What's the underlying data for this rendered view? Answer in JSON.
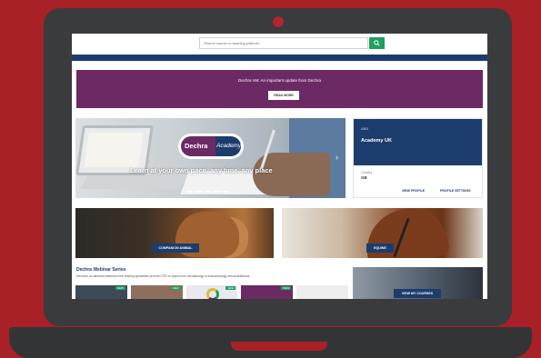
{
  "search": {
    "placeholder": "Search course or learning platform"
  },
  "banner": {
    "text": "Dechra Vet: An important update from Dechra",
    "button_label": "READ MORE"
  },
  "hero": {
    "logo_left": "Dechra",
    "logo_right": "Academy",
    "caption": "Learn at your own pace, any time, any place"
  },
  "side_card": {
    "small_text": "ABS",
    "title": "Academy UK",
    "field_label": "Country",
    "field_value": "GB",
    "link_1": "VIEW PROFILE",
    "link_2": "PROFILE SETTINGS"
  },
  "tiles": {
    "companion_label": "COMPANION ANIMAL",
    "equine_label": "EQUINE"
  },
  "webinars": {
    "title": "Dechra Webinar Series",
    "description": "Dechra's on-demand webinars from leading specialists provide CPD on topics from dermatology to endocrinology and anaesthesia.",
    "badge": "NEW"
  },
  "courses": {
    "button_label": "VIEW MY COURSES"
  },
  "colors": {
    "background": "#a82127",
    "brand_navy": "#1c3c6e",
    "brand_purple": "#6b2a63",
    "accent_green": "#1f9e5f"
  }
}
